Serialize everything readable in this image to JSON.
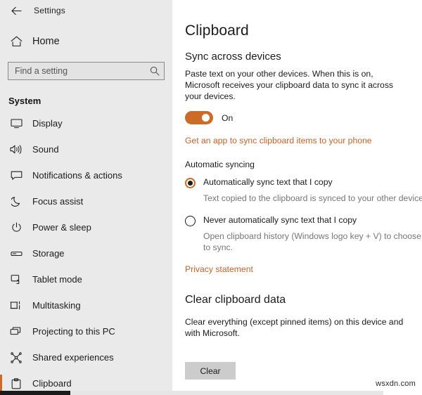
{
  "window": {
    "back_icon": "back-arrow-icon",
    "app_title": "Settings"
  },
  "sidebar": {
    "home": {
      "label": "Home",
      "icon": "home-icon"
    },
    "search": {
      "placeholder": "Find a setting",
      "value": "",
      "icon": "search-icon"
    },
    "section_title": "System",
    "items": [
      {
        "label": "Display",
        "icon": "monitor-icon",
        "selected": false
      },
      {
        "label": "Sound",
        "icon": "speaker-icon",
        "selected": false
      },
      {
        "label": "Notifications & actions",
        "icon": "notification-icon",
        "selected": false
      },
      {
        "label": "Focus assist",
        "icon": "moon-icon",
        "selected": false
      },
      {
        "label": "Power & sleep",
        "icon": "power-icon",
        "selected": false
      },
      {
        "label": "Storage",
        "icon": "drive-icon",
        "selected": false
      },
      {
        "label": "Tablet mode",
        "icon": "tablet-icon",
        "selected": false
      },
      {
        "label": "Multitasking",
        "icon": "multitasking-icon",
        "selected": false
      },
      {
        "label": "Projecting to this PC",
        "icon": "project-screen-icon",
        "selected": false
      },
      {
        "label": "Shared experiences",
        "icon": "share-nodes-icon",
        "selected": false
      },
      {
        "label": "Clipboard",
        "icon": "clipboard-icon",
        "selected": true
      }
    ]
  },
  "main": {
    "page_title": "Clipboard",
    "sync_section": {
      "heading": "Sync across devices",
      "description": "Paste text on your other devices. When this is on, Microsoft receives your clipboard data to sync it across your devices.",
      "toggle_state": "On",
      "toggle_on": true,
      "app_link": "Get an app to sync clipboard items to your phone"
    },
    "auto_sync": {
      "group_label": "Automatic syncing",
      "options": [
        {
          "label": "Automatically sync text that I copy",
          "description": "Text copied to the clipboard is synced to your other devices.",
          "selected": true
        },
        {
          "label": "Never automatically sync text that I copy",
          "description": "Open clipboard history (Windows logo key + V) to choose text to sync.",
          "selected": false
        }
      ],
      "privacy_link": "Privacy statement"
    },
    "clear_section": {
      "heading": "Clear clipboard data",
      "description": "Clear everything (except pinned items) on this device and with Microsoft.",
      "button_label": "Clear"
    }
  },
  "watermark": "wsxdn.com",
  "colors": {
    "accent": "#cc6a28",
    "link": "#c2632a",
    "sidebar_bg": "#eaeaea",
    "content_bg": "#ffffff",
    "text": "#1b1b1b",
    "muted_text": "#767676",
    "button_bg": "#cccccc"
  }
}
